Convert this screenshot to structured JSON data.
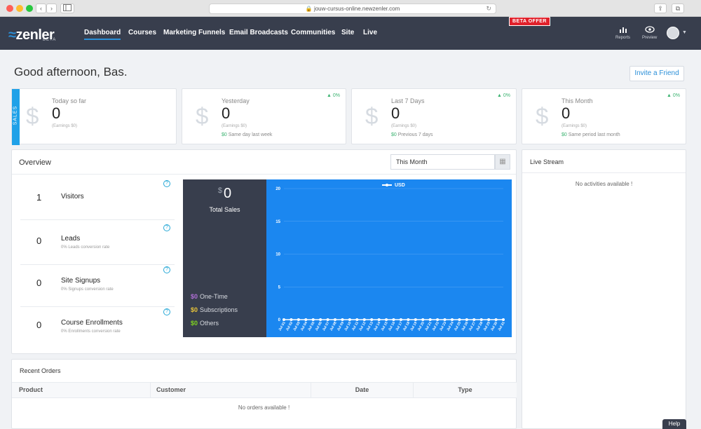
{
  "browser": {
    "url": "jouw-cursus-online.newzenler.com",
    "back_label": "‹",
    "forward_label": "›"
  },
  "nav": {
    "logo_text": "zenler",
    "logo_badge": "BETA",
    "beta_offer": "BETA OFFER",
    "items": [
      "Dashboard",
      "Courses",
      "Marketing Funnels",
      "Email Broadcasts",
      "Communities",
      "Site",
      "Live"
    ],
    "active_item": "Dashboard",
    "reports_label": "Reports",
    "preview_label": "Preview"
  },
  "greeting": "Good afternoon, Bas.",
  "invite_label": "Invite a Friend",
  "stats": {
    "sales_tab": "SALES",
    "cards": [
      {
        "label": "Today so far",
        "value": "0",
        "earnings": "(Earnings $0)",
        "pct": "",
        "compare_amount": "",
        "compare_text": ""
      },
      {
        "label": "Yesterday",
        "value": "0",
        "earnings": "(Earnings $0)",
        "pct": "0%",
        "compare_amount": "$0",
        "compare_text": "Same day last week"
      },
      {
        "label": "Last 7 Days",
        "value": "0",
        "earnings": "(Earnings $0)",
        "pct": "0%",
        "compare_amount": "$0",
        "compare_text": "Previous 7 days"
      },
      {
        "label": "This Month",
        "value": "0",
        "earnings": "(Earnings $0)",
        "pct": "0%",
        "compare_amount": "$0",
        "compare_text": "Same period last month"
      }
    ]
  },
  "overview": {
    "title": "Overview",
    "period": "This Month",
    "metrics": [
      {
        "value": "1",
        "name": "Visitors",
        "sub": ""
      },
      {
        "value": "0",
        "name": "Leads",
        "sub": "0% Leads conversion rate"
      },
      {
        "value": "0",
        "name": "Site Signups",
        "sub": "0% Signups conversion rate"
      },
      {
        "value": "0",
        "name": "Course Enrollments",
        "sub": "0% Enrollments conversion rate"
      }
    ],
    "total_sales": {
      "currency": "$",
      "value": "0",
      "label": "Total Sales",
      "breakdown": [
        {
          "amount": "0",
          "label": "One-Time",
          "color": "#b06fd6"
        },
        {
          "amount": "0",
          "label": "Subscriptions",
          "color": "#e8c43a"
        },
        {
          "amount": "0",
          "label": "Others",
          "color": "#7ed321"
        }
      ]
    }
  },
  "chart_data": {
    "type": "line",
    "series": [
      {
        "name": "USD",
        "values": [
          0,
          0,
          0,
          0,
          0,
          0,
          0,
          0,
          0,
          0,
          0,
          0,
          0,
          0,
          0,
          0,
          0,
          0,
          0,
          0,
          0,
          0,
          0,
          0,
          0,
          0,
          0,
          0,
          0,
          0,
          0
        ]
      }
    ],
    "categories": [
      "Jul 01",
      "Jul 02",
      "Jul 03",
      "Jul 04",
      "Jul 05",
      "Jul 06",
      "Jul 07",
      "Jul 08",
      "Jul 09",
      "Jul 10",
      "Jul 11",
      "Jul 12",
      "Jul 13",
      "Jul 14",
      "Jul 15",
      "Jul 16",
      "Jul 17",
      "Jul 18",
      "Jul 19",
      "Jul 20",
      "Jul 21",
      "Jul 22",
      "Jul 23",
      "Jul 24",
      "Jul 25",
      "Jul 26",
      "Jul 27",
      "Jul 28",
      "Jul 29",
      "Jul 30",
      "Jul 31"
    ],
    "ylim": [
      0,
      20
    ],
    "yticks": [
      0,
      5,
      10,
      15,
      20
    ],
    "legend_position": "top",
    "grid": true,
    "background": "#1b87f0"
  },
  "live_stream": {
    "title": "Live Stream",
    "empty": "No activities available !"
  },
  "recent_orders": {
    "title": "Recent Orders",
    "columns": [
      "Product",
      "Customer",
      "Date",
      "Type"
    ],
    "empty": "No orders available !"
  },
  "help_label": "Help",
  "colors": {
    "nav_bg": "#383e4d",
    "accent": "#2b8fd8",
    "sales_tab": "#1fa1e8",
    "positive": "#3cb371"
  }
}
